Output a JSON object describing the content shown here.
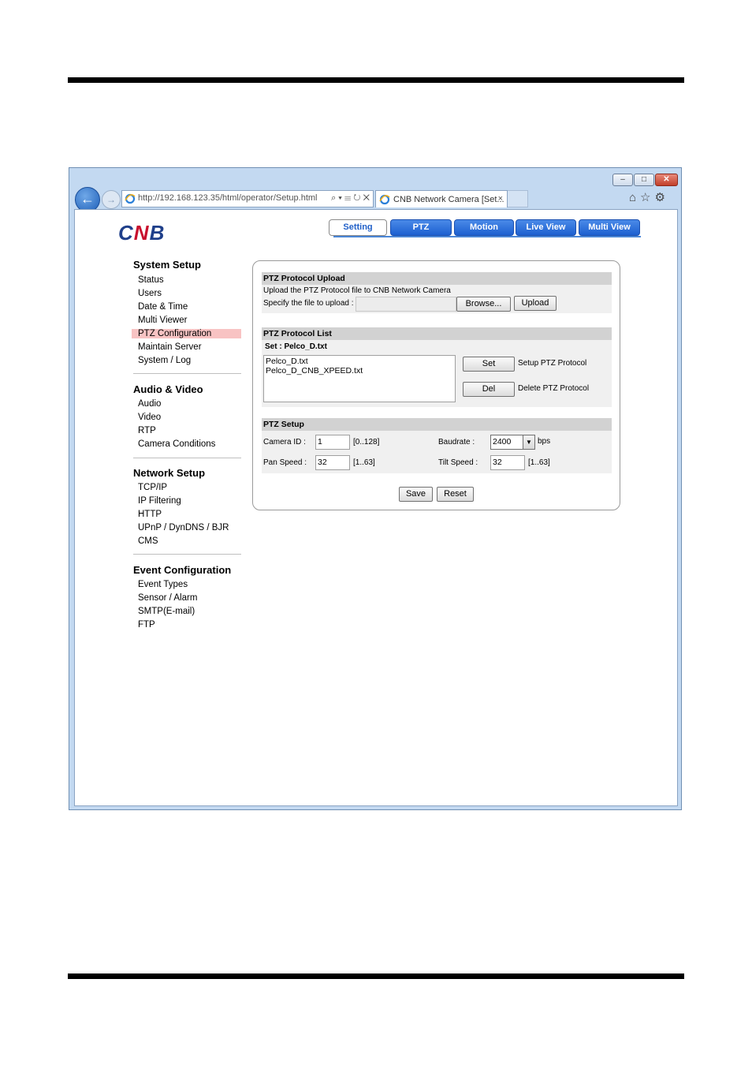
{
  "browser": {
    "address": "http://192.168.123.35/html/operator/Setup.html",
    "address_tools": "⌕ ▾ ☰ ↻ ✕",
    "tab_title": "CNB Network Camera [Set...",
    "tab_close": "×",
    "window_min": "–",
    "window_max": "□",
    "window_close": "✕",
    "nav_icons": "⌂☆⚙",
    "back_glyph": "←",
    "forward_glyph": "→",
    "icons": [
      "back-icon",
      "forward-icon",
      "ie-icon",
      "home-icon",
      "favorites-icon",
      "settings-icon"
    ]
  },
  "logo": {
    "c": "C",
    "n": "N",
    "b": "B"
  },
  "menu": {
    "setting": "Setting",
    "ptz": "PTZ",
    "motion": "Motion",
    "live_view": "Live View",
    "multi_view": "Multi View"
  },
  "sidebar": {
    "system_setup": {
      "title": "System Setup",
      "items": [
        "Status",
        "Users",
        "Date & Time",
        "Multi Viewer",
        "PTZ Configuration",
        "Maintain Server",
        "System / Log"
      ]
    },
    "audio_video": {
      "title": "Audio & Video",
      "items": [
        "Audio",
        "Video",
        "RTP",
        "Camera Conditions"
      ]
    },
    "network_setup": {
      "title": "Network Setup",
      "items": [
        "TCP/IP",
        "IP Filtering",
        "HTTP",
        "UPnP / DynDNS / BJR",
        "CMS"
      ]
    },
    "event_configuration": {
      "title": "Event Configuration",
      "items": [
        "Event Types",
        "Sensor / Alarm",
        "SMTP(E-mail)",
        "FTP"
      ]
    }
  },
  "upload": {
    "title": "PTZ Protocol Upload",
    "description": "Upload the PTZ Protocol file to CNB Network Camera",
    "specify_label": "Specify the file to upload :",
    "file_value": "",
    "browse_label": "Browse...",
    "upload_label": "Upload"
  },
  "protocol_list": {
    "title": "PTZ Protocol List",
    "current": "Set : Pelco_D.txt",
    "files": [
      "Pelco_D.txt",
      "Pelco_D_CNB_XPEED.txt"
    ],
    "set_label": "Set",
    "set_desc": "Setup PTZ Protocol",
    "del_label": "Del",
    "del_desc": "Delete PTZ Protocol"
  },
  "ptz_setup": {
    "title": "PTZ Setup",
    "camera_id_label": "Camera ID :",
    "camera_id_value": "1",
    "camera_id_range": "[0..128]",
    "baudrate_label": "Baudrate :",
    "baudrate_value": "2400",
    "baudrate_unit": "bps",
    "pan_speed_label": "Pan Speed :",
    "pan_speed_value": "32",
    "pan_speed_range": "[1..63]",
    "tilt_speed_label": "Tilt Speed :",
    "tilt_speed_value": "32",
    "tilt_speed_range": "[1..63]"
  },
  "actions": {
    "save_label": "Save",
    "reset_label": "Reset"
  }
}
